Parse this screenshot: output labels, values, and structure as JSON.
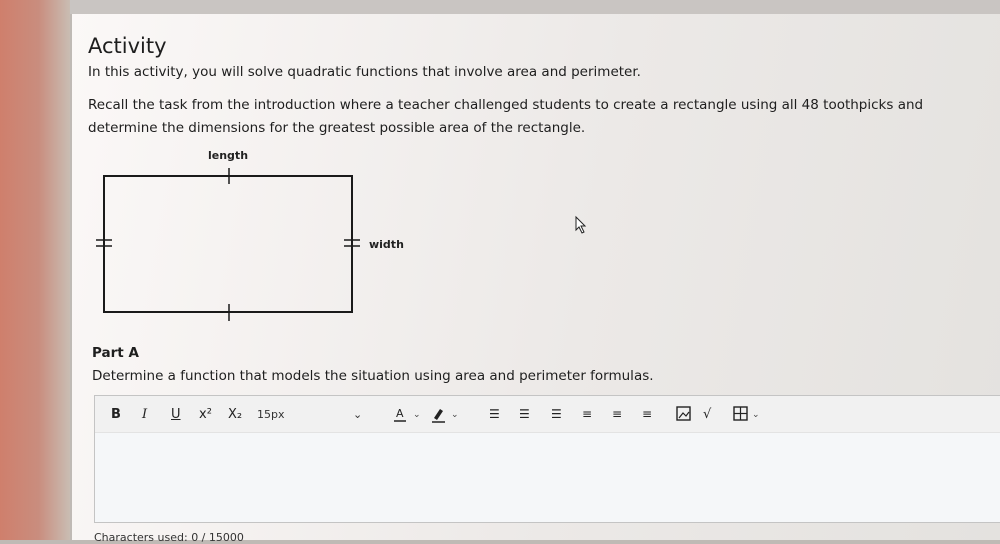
{
  "activity": {
    "title": "Activity",
    "intro": "In this activity, you will solve quadratic functions that involve area and perimeter.",
    "recall": "Recall the task from the introduction where a teacher challenged students to create a rectangle using all 48 toothpicks and determine the dimensions for the greatest possible area of the rectangle."
  },
  "diagram": {
    "length_label": "length",
    "width_label": "width"
  },
  "part_a": {
    "heading": "Part A",
    "prompt": "Determine a function that models the situation using area and perimeter formulas."
  },
  "editor": {
    "toolbar": {
      "bold": "B",
      "italic": "I",
      "underline": "U",
      "superscript": "x²",
      "subscript": "X₂",
      "font_size": "15px"
    },
    "value": "",
    "characters_used": "Characters used: 0 / 15000"
  },
  "colors": {
    "page_bg": "#bfbab5",
    "card_bg": "#f7f4f3",
    "editor_bg": "#f5f7f9",
    "left_band": "#cf7f6c"
  }
}
